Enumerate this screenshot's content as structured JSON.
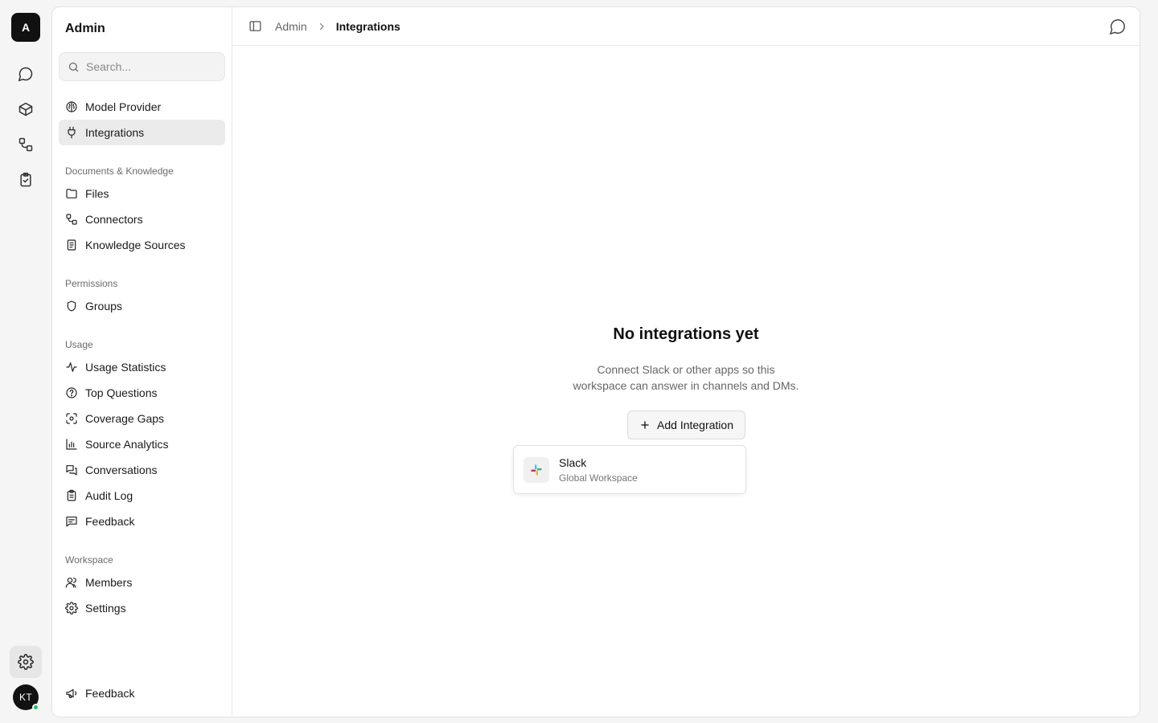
{
  "rail": {
    "logo_letter": "A",
    "avatar_initials": "KT"
  },
  "sidebar": {
    "title": "Admin",
    "search_placeholder": "Search...",
    "top_items": [
      {
        "label": "Model Provider",
        "icon": "brain-icon"
      },
      {
        "label": "Integrations",
        "icon": "plug-icon",
        "active": true
      }
    ],
    "sections": [
      {
        "title": "Documents & Knowledge",
        "items": [
          {
            "label": "Files",
            "icon": "folder-icon"
          },
          {
            "label": "Connectors",
            "icon": "connectors-icon"
          },
          {
            "label": "Knowledge Sources",
            "icon": "book-icon"
          }
        ]
      },
      {
        "title": "Permissions",
        "items": [
          {
            "label": "Groups",
            "icon": "shield-icon"
          }
        ]
      },
      {
        "title": "Usage",
        "items": [
          {
            "label": "Usage Statistics",
            "icon": "activity-icon"
          },
          {
            "label": "Top Questions",
            "icon": "question-icon"
          },
          {
            "label": "Coverage Gaps",
            "icon": "scan-icon"
          },
          {
            "label": "Source Analytics",
            "icon": "bar-chart-icon"
          },
          {
            "label": "Conversations",
            "icon": "messages-icon"
          },
          {
            "label": "Audit Log",
            "icon": "clipboard-icon"
          },
          {
            "label": "Feedback",
            "icon": "message-square-icon"
          }
        ]
      },
      {
        "title": "Workspace",
        "items": [
          {
            "label": "Members",
            "icon": "users-icon"
          },
          {
            "label": "Settings",
            "icon": "gear-icon"
          }
        ]
      }
    ],
    "footer_feedback": "Feedback"
  },
  "header": {
    "breadcrumb_parent": "Admin",
    "breadcrumb_current": "Integrations"
  },
  "main": {
    "empty_title": "No integrations yet",
    "empty_desc_line1": "Connect Slack or other apps so this",
    "empty_desc_line2": "workspace can answer in channels and DMs.",
    "add_button_label": "Add Integration",
    "dropdown_item": {
      "name": "Slack",
      "subtitle": "Global Workspace"
    }
  },
  "colors": {
    "online": "#22c55e",
    "active_bg": "#ebebeb"
  }
}
